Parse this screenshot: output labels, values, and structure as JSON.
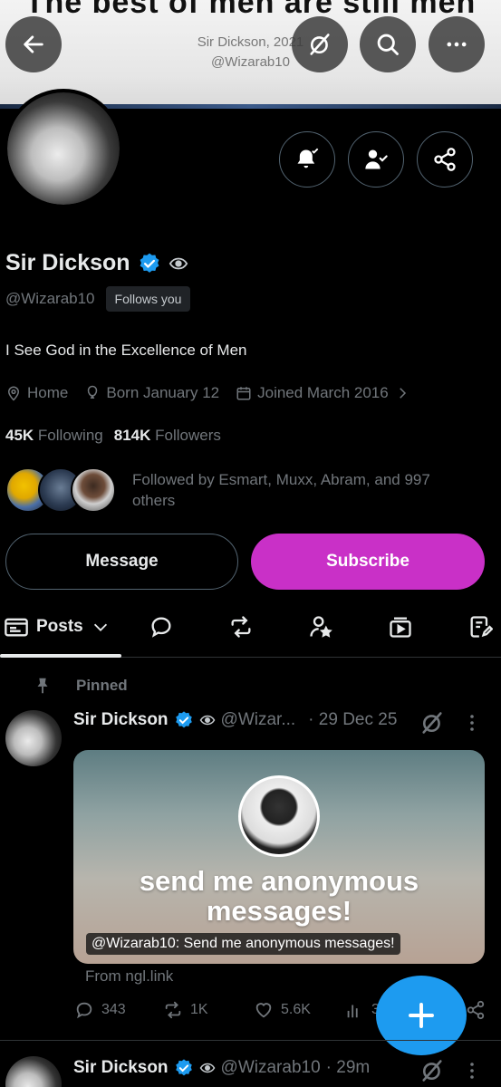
{
  "banner": {
    "headline": "The best of men are still men",
    "credit_name": "Sir Dickson, 2021",
    "credit_handle": "@Wizarab10"
  },
  "top_bar": {
    "back_icon": "back-arrow-icon",
    "grok_icon": "grok-icon",
    "search_icon": "search-icon",
    "more_icon": "more-horizontal-icon"
  },
  "profile": {
    "display_name": "Sir Dickson",
    "handle": "@Wizarab10",
    "follows_you": "Follows you",
    "bio": "I See God in the Excellence of Men",
    "location": "Home",
    "birthday": "Born January 12",
    "joined": "Joined March 2016",
    "following_count": "45K",
    "following_label": "Following",
    "followers_count": "814K",
    "followers_label": "Followers",
    "followed_by": "Followed by Esmart, Muxx, Abram, and 997 others"
  },
  "buttons": {
    "message": "Message",
    "subscribe": "Subscribe"
  },
  "tabs": {
    "posts": "Posts"
  },
  "pinned": {
    "label": "Pinned",
    "author": "Sir Dickson",
    "handle": "@Wizar...",
    "date": "· 29 Dec 25",
    "card_title": "send me anonymous messages!",
    "card_caption": "@Wizarab10: Send me anonymous messages!",
    "source": "From ngl.link",
    "replies": "343",
    "reposts": "1K",
    "likes": "5.6K",
    "views": "3.4"
  },
  "next_post": {
    "author": "Sir Dickson",
    "handle": "@Wizarab10",
    "time": "· 29m"
  },
  "colors": {
    "accent_blue": "#1d9bf0",
    "subscribe_purple": "#c930c7",
    "muted_text": "#71767b",
    "background": "#000000"
  }
}
